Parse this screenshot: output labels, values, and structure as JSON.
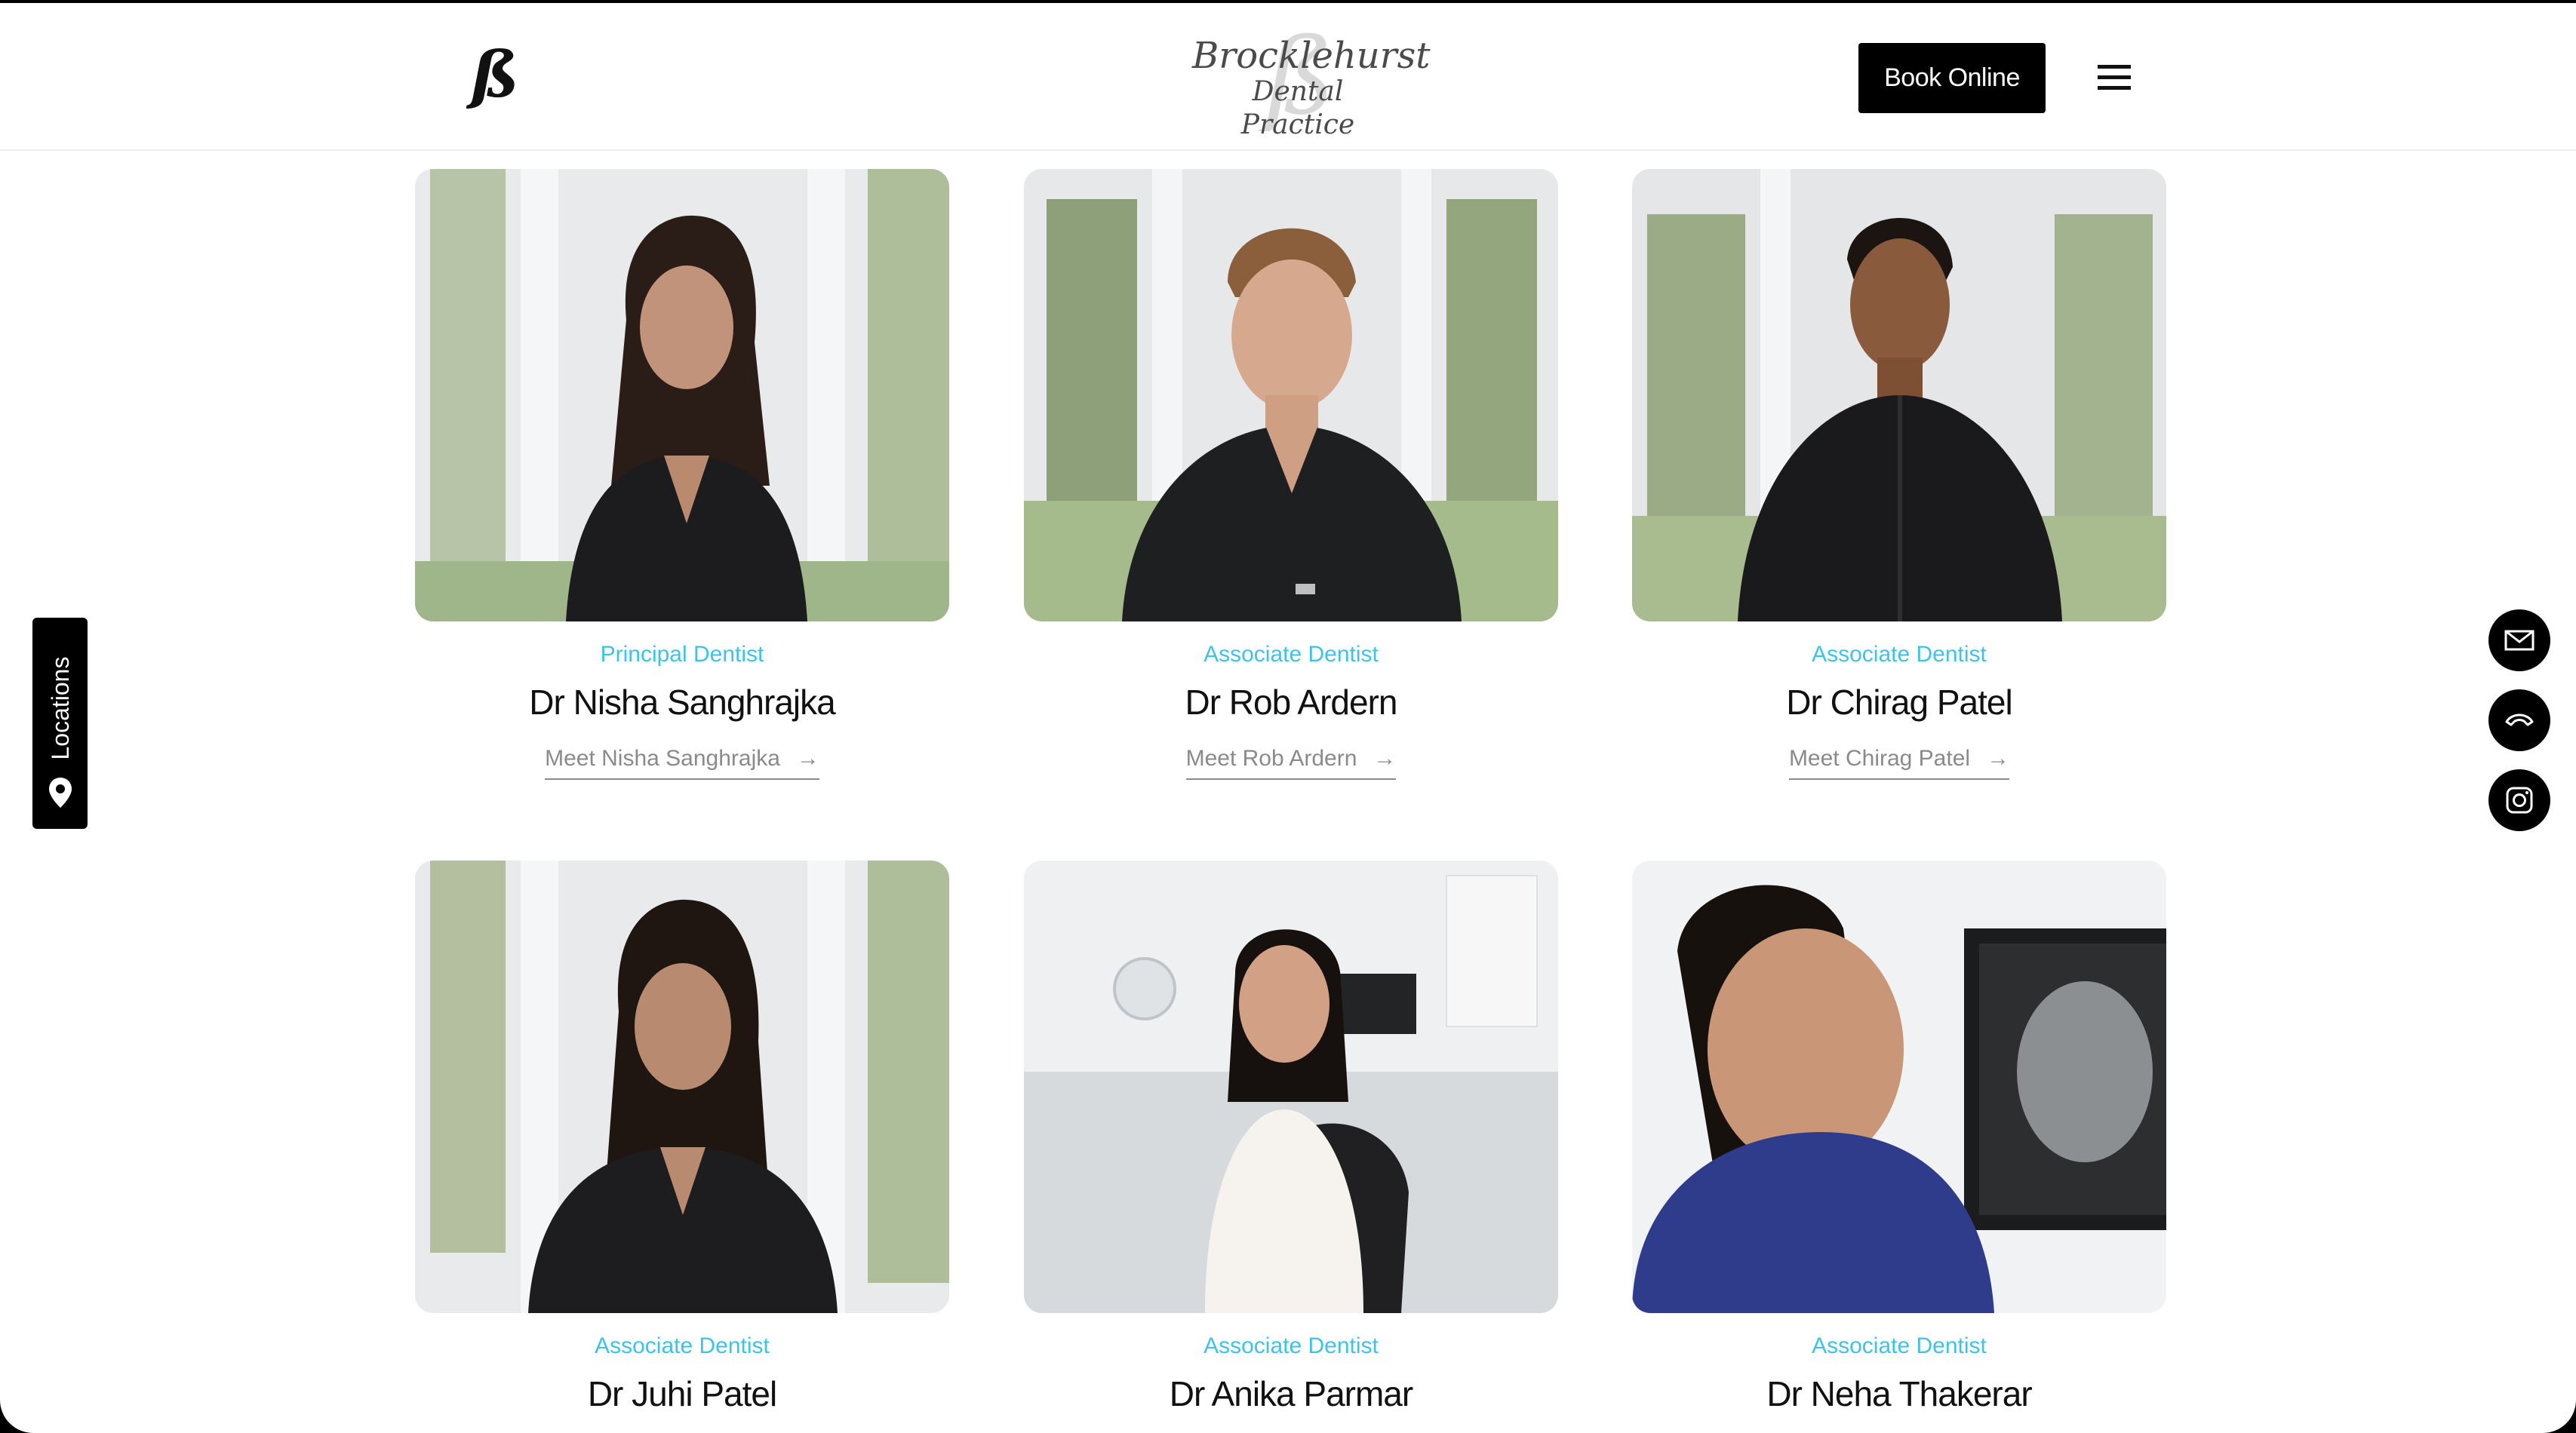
{
  "header": {
    "logo_glyph": "ß",
    "brand_name": "Brocklehurst",
    "brand_sub": "Dental Practice",
    "book_label": "Book Online",
    "menu_icon": "hamburger-menu-icon"
  },
  "side_tab": {
    "label": "Locations",
    "icon": "map-pin-icon"
  },
  "social": [
    {
      "icon": "mail-icon"
    },
    {
      "icon": "phone-icon"
    },
    {
      "icon": "instagram-icon"
    }
  ],
  "team": [
    {
      "role": "Principal Dentist",
      "name": "Dr Nisha Sanghrajka",
      "link": "Meet Nisha Sanghrajka",
      "arrow": "→"
    },
    {
      "role": "Associate Dentist",
      "name": "Dr Rob Ardern",
      "link": "Meet Rob Ardern",
      "arrow": "→"
    },
    {
      "role": "Associate Dentist",
      "name": "Dr Chirag Patel",
      "link": "Meet Chirag Patel",
      "arrow": "→"
    },
    {
      "role": "Associate Dentist",
      "name": "Dr Juhi Patel"
    },
    {
      "role": "Associate Dentist",
      "name": "Dr Anika Parmar"
    },
    {
      "role": "Associate Dentist",
      "name": "Dr Neha Thakerar"
    }
  ],
  "colors": {
    "accent": "#3ec3e6",
    "button_bg": "#000000",
    "text": "#111111",
    "link": "#8a8a8a"
  }
}
